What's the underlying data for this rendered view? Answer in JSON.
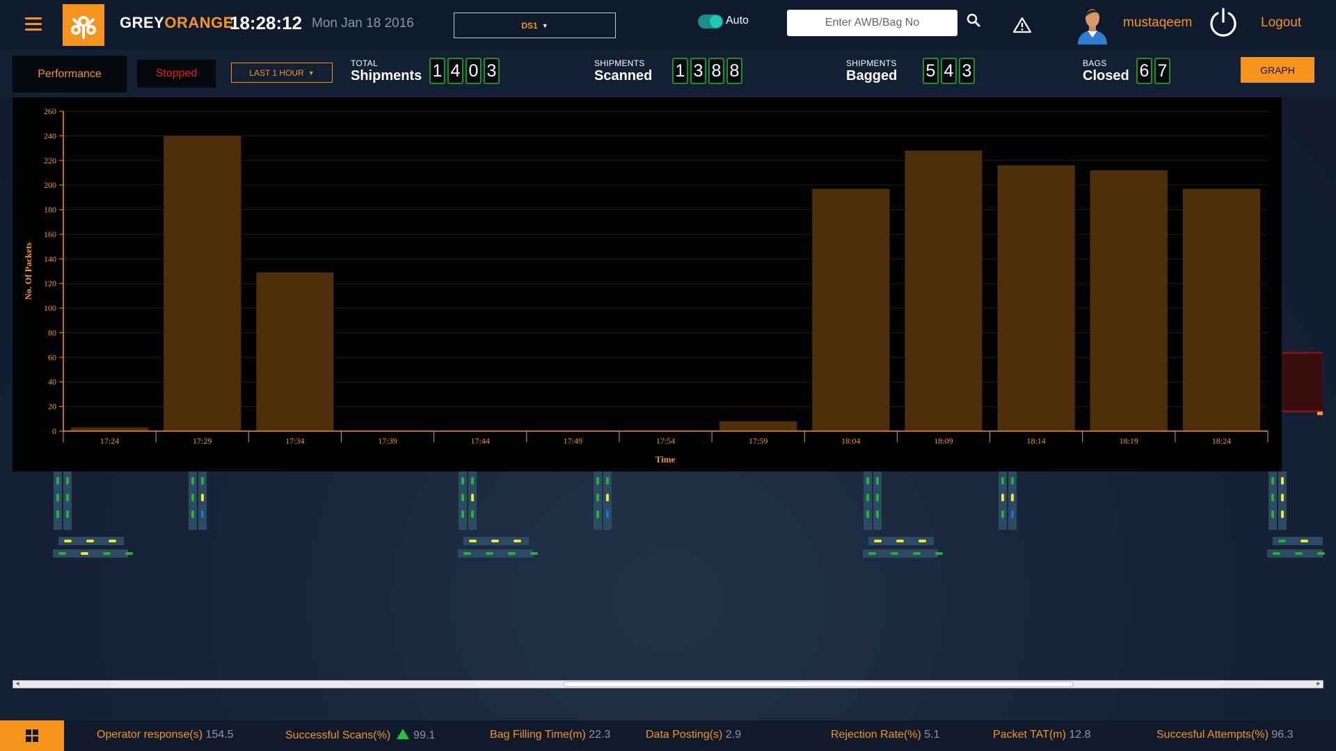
{
  "header": {
    "brand_grey": "GREY",
    "brand_orange": "ORANGE",
    "time": "18:28:12",
    "date": "Mon Jan 18 2016",
    "station": "DS1",
    "auto_label": "Auto",
    "auto_enabled": true,
    "search_placeholder": "Enter AWB/Bag No",
    "username": "mustaqeem",
    "logout_label": "Logout"
  },
  "statsbar": {
    "performance_label": "Performance",
    "status_label": "Stopped",
    "range_label": "LAST 1 HOUR",
    "total_small": "TOTAL",
    "total_big": "Shipments",
    "total_digits": [
      "1",
      "4",
      "0",
      "3"
    ],
    "scanned_small": "SHIPMENTS",
    "scanned_big": "Scanned",
    "scanned_digits": [
      "1",
      "3",
      "8",
      "8"
    ],
    "bagged_small": "SHIPMENTS",
    "bagged_big": "Bagged",
    "bagged_digits": [
      "5",
      "4",
      "3"
    ],
    "closed_small": "BAGS",
    "closed_big": "Closed",
    "closed_digits": [
      "6",
      "7"
    ],
    "graph_label": "GRAPH"
  },
  "chart_data": {
    "type": "bar",
    "categories": [
      "17:24",
      "17:29",
      "17:34",
      "17:39",
      "17:44",
      "17:49",
      "17:54",
      "17:59",
      "18:04",
      "18:09",
      "18:14",
      "18:19",
      "18:24"
    ],
    "values": [
      3,
      240,
      129,
      0,
      0,
      0,
      0,
      8,
      197,
      228,
      216,
      212,
      197
    ],
    "xlabel": "Time",
    "ylabel": "No. Of Packets",
    "ylim": [
      0,
      260
    ],
    "yticks": [
      0,
      20,
      40,
      60,
      80,
      100,
      120,
      140,
      160,
      180,
      200,
      220,
      240,
      260
    ],
    "bar_color": "#4f2f0b",
    "grid": true
  },
  "footer": {
    "metrics": [
      {
        "label": "Operator response(s)",
        "value": "154.5"
      },
      {
        "label": "Successful Scans(%)",
        "value": "99.1",
        "trend": "up"
      },
      {
        "label": "Bag Filling Time(m)",
        "value": "22.3"
      },
      {
        "label": "Data Posting(s)",
        "value": "2.9"
      },
      {
        "label": "Rejection Rate(%)",
        "value": "5.1"
      },
      {
        "label": "Packet TAT(m)",
        "value": "12.8"
      },
      {
        "label": "Succesful Attempts(%)",
        "value": "96.3"
      }
    ]
  },
  "colors": {
    "accent": "#f7941d",
    "stopped": "#e2231a",
    "digit_border": "#1f8f2c",
    "slot_green": "#1fb52e",
    "slot_yellow": "#f0e62a",
    "slot_blue": "#1f6fd6"
  }
}
